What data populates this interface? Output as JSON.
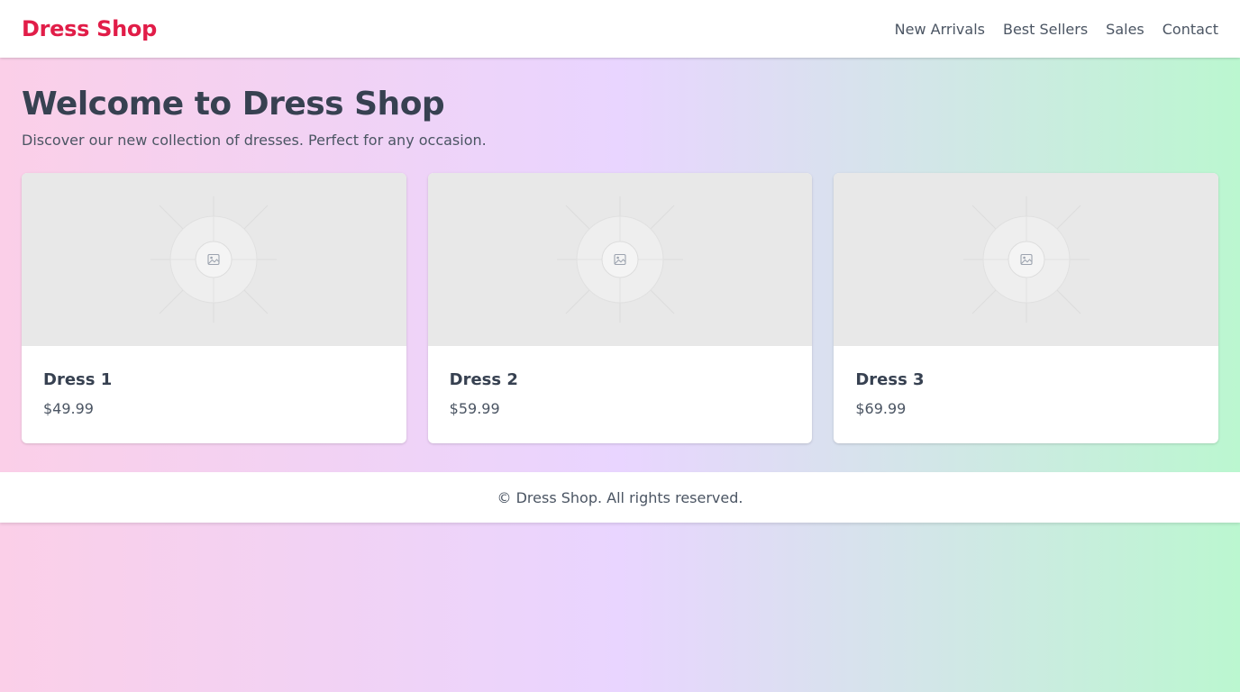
{
  "header": {
    "brand": "Dress Shop",
    "nav": [
      {
        "label": "New Arrivals"
      },
      {
        "label": "Best Sellers"
      },
      {
        "label": "Sales"
      },
      {
        "label": "Contact"
      }
    ]
  },
  "hero": {
    "title": "Welcome to Dress Shop",
    "subtitle": "Discover our new collection of dresses. Perfect for any occasion."
  },
  "products": [
    {
      "name": "Dress 1",
      "price": "$49.99",
      "image_icon": "image-placeholder-icon"
    },
    {
      "name": "Dress 2",
      "price": "$59.99",
      "image_icon": "image-placeholder-icon"
    },
    {
      "name": "Dress 3",
      "price": "$69.99",
      "image_icon": "image-placeholder-icon"
    }
  ],
  "footer": {
    "text": "© Dress Shop. All rights reserved."
  },
  "colors": {
    "brand": "#e11d48",
    "text": "#374151",
    "muted": "#4b5563",
    "gradient_start": "#fbcfe8",
    "gradient_mid": "#e9d5ff",
    "gradient_end": "#bbf7d0",
    "placeholder_bg": "#e8e8e8"
  }
}
